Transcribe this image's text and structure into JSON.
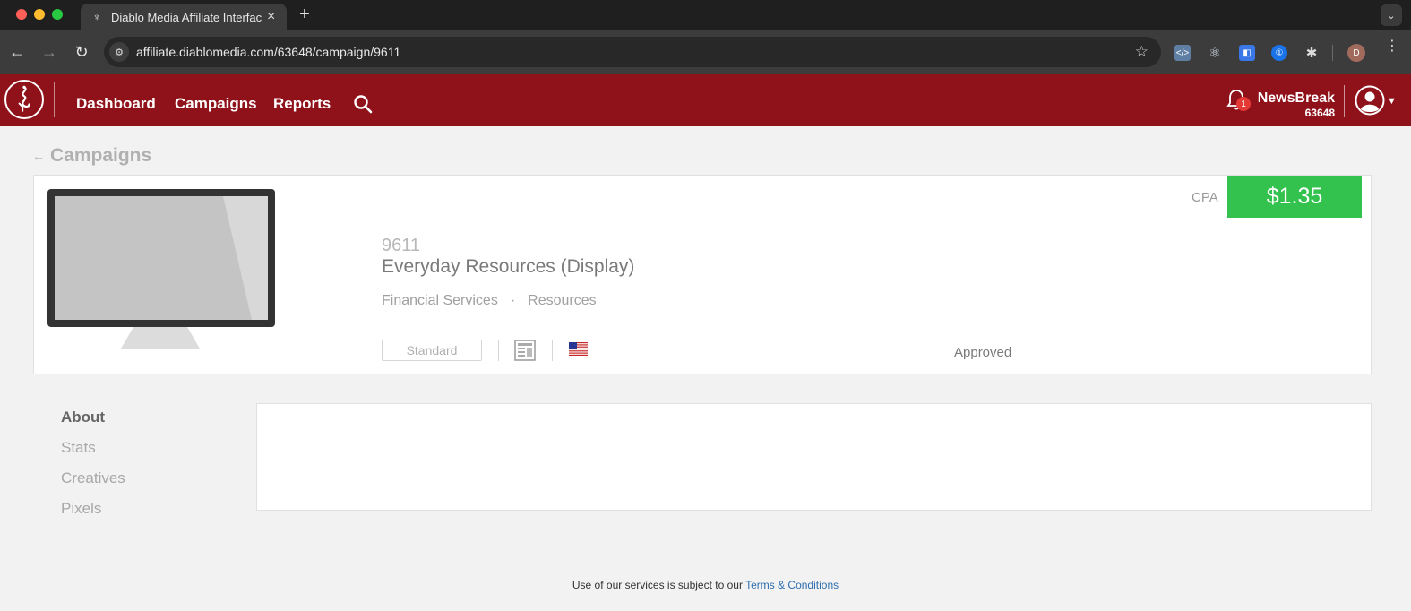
{
  "browser": {
    "tab_title": "Diablo Media Affiliate Interface",
    "url": "affiliate.diablomedia.com/63648/campaign/9611",
    "profile_initial": "D"
  },
  "header": {
    "nav": {
      "dashboard": "Dashboard",
      "campaigns": "Campaigns",
      "reports": "Reports"
    },
    "notification_count": "1",
    "account_name": "NewsBreak",
    "account_id": "63648"
  },
  "back_link": "Campaigns",
  "campaign": {
    "id": "9611",
    "name": "Everyday Resources (Display)",
    "category": "Financial Services",
    "separator": "·",
    "subcategory": "Resources",
    "payout_type": "CPA",
    "payout": "$1.35",
    "type_badge": "Standard",
    "status": "Approved",
    "price_color": "#34c24f"
  },
  "side_nav": {
    "about": "About",
    "stats": "Stats",
    "creatives": "Creatives",
    "pixels": "Pixels"
  },
  "footer": {
    "text": "Use of our services is subject to our",
    "link": "Terms & Conditions"
  },
  "colors": {
    "header_bg": "#8f121a",
    "page_bg": "#f2f2f2"
  }
}
